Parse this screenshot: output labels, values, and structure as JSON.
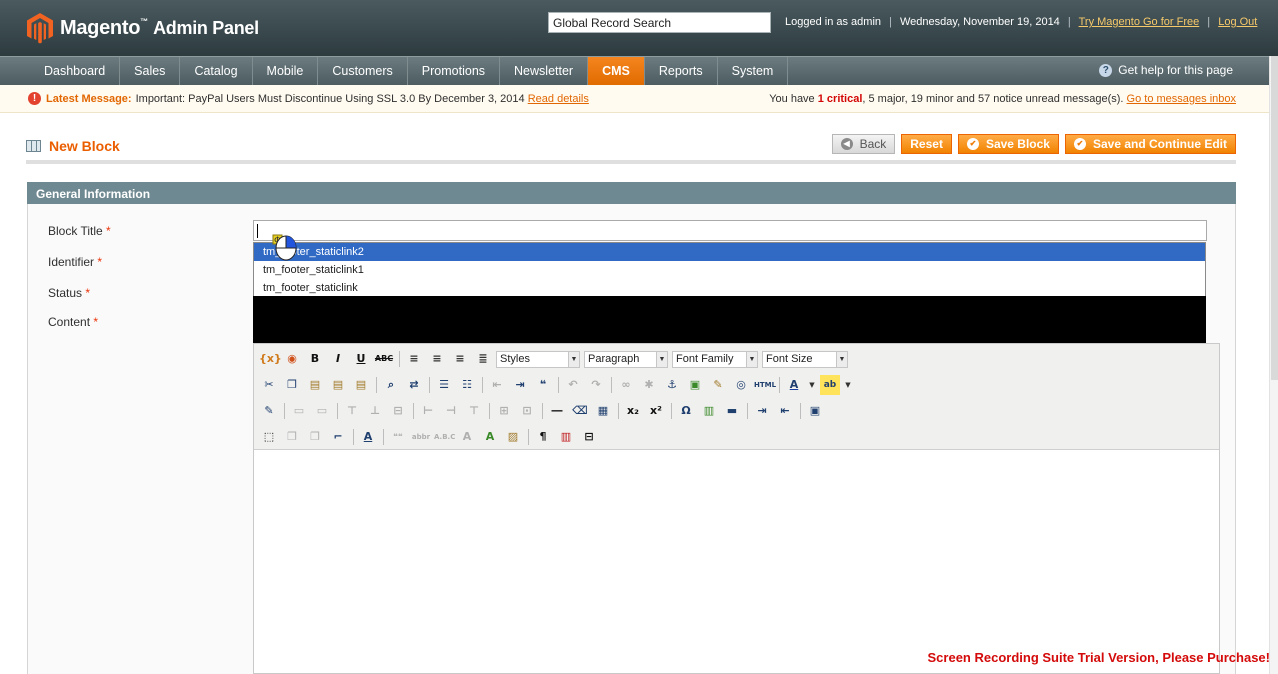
{
  "header": {
    "logo_text": "Magento",
    "logo_sub": "Admin Panel",
    "search_value": "Global Record Search",
    "logged_in": "Logged in as admin",
    "date": "Wednesday, November 19, 2014",
    "try_link": "Try Magento Go for Free",
    "logout": "Log Out"
  },
  "nav": {
    "items": [
      "Dashboard",
      "Sales",
      "Catalog",
      "Mobile",
      "Customers",
      "Promotions",
      "Newsletter",
      "CMS",
      "Reports",
      "System"
    ],
    "active": "CMS",
    "help": "Get help for this page"
  },
  "message": {
    "label": "Latest Message:",
    "text": "Important: PayPal Users Must Discontinue Using SSL 3.0 By December 3, 2014",
    "link": "Read details",
    "summary_prefix": "You have",
    "critical": "1 critical",
    "summary_rest": ", 5 major, 19 minor and 57 notice unread message(s).",
    "inbox_link": "Go to messages inbox"
  },
  "page": {
    "title": "New Block",
    "buttons": {
      "back": "Back",
      "reset": "Reset",
      "save": "Save Block",
      "save_continue": "Save and Continue Edit"
    }
  },
  "section": {
    "title": "General Information",
    "labels": {
      "block_title": "Block Title",
      "identifier": "Identifier",
      "status": "Status",
      "content": "Content"
    },
    "required_mark": "*"
  },
  "autocomplete": [
    "tm_footer_staticlink2",
    "tm_footer_staticlink1",
    "tm_footer_staticlink"
  ],
  "editor": {
    "styles": "Styles",
    "paragraph": "Paragraph",
    "font_family": "Font Family",
    "font_size": "Font Size"
  },
  "watermark": "Screen Recording Suite Trial Version, Please Purchase!"
}
